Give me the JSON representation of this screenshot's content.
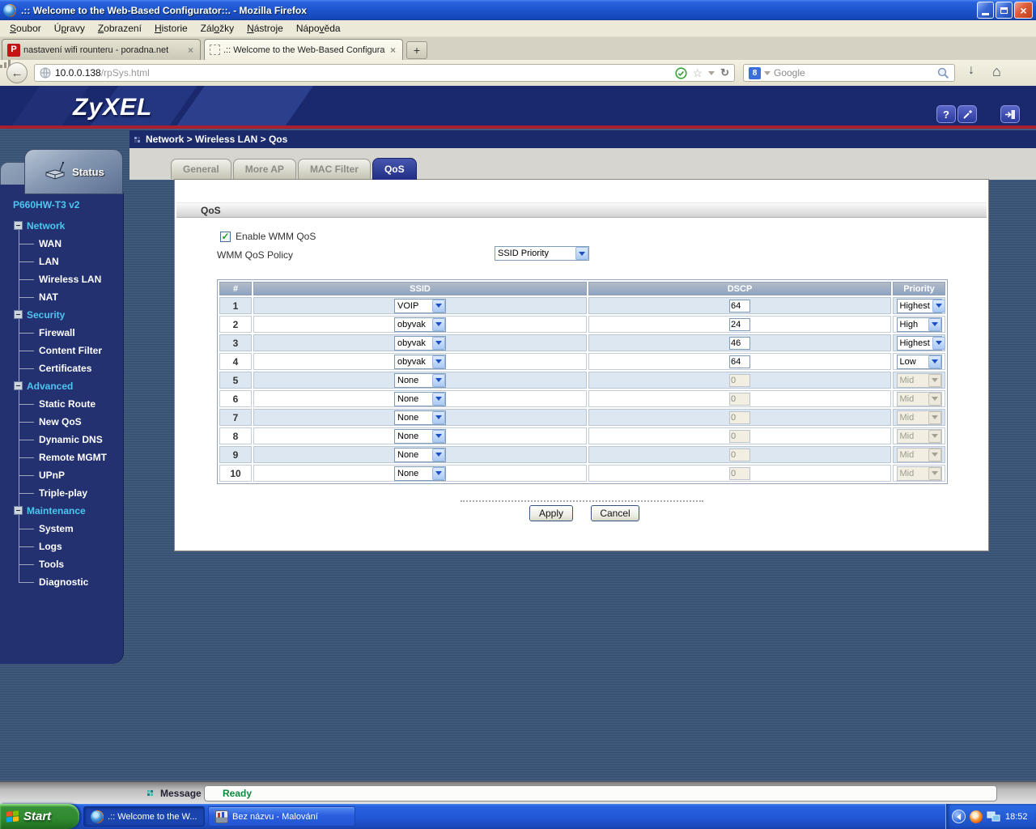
{
  "browser": {
    "title": ".:: Welcome to the Web-Based Configurator::. - Mozilla Firefox",
    "menu": [
      {
        "label": "Soubor",
        "accel": 0
      },
      {
        "label": "Úpravy",
        "accel": 1
      },
      {
        "label": "Zobrazení",
        "accel": 0
      },
      {
        "label": "Historie",
        "accel": 0
      },
      {
        "label": "Záložky",
        "accel": 3
      },
      {
        "label": "Nástroje",
        "accel": 0
      },
      {
        "label": "Nápověda",
        "accel": 4
      }
    ],
    "tabs": [
      {
        "label": "nastavení wifi rounteru - poradna.net",
        "active": false,
        "icon": "poradna"
      },
      {
        "label": ".:: Welcome to the Web-Based Configura...",
        "active": true,
        "icon": "none"
      }
    ],
    "new_tab_label": "+",
    "url": {
      "host": "10.0.0.138",
      "path": "/rpSys.html"
    },
    "search": {
      "engine": "Google"
    }
  },
  "icons": {
    "back": "←",
    "star": "☆",
    "reload": "↻",
    "download": "↓",
    "home": "⌂",
    "close": "×",
    "minimize": "—",
    "help": "?",
    "checkmark": "✓",
    "poradna_letter": "P",
    "google_letter": "8",
    "tab_close": "×"
  },
  "zyxel": {
    "logo": "ZyXEL",
    "breadcrumb": "Network > Wireless LAN > Qos",
    "status_label": "Status",
    "device": "P660HW-T3 v2",
    "nav": [
      {
        "label": "Network",
        "children": [
          "WAN",
          "LAN",
          "Wireless LAN",
          "NAT"
        ]
      },
      {
        "label": "Security",
        "children": [
          "Firewall",
          "Content Filter",
          "Certificates"
        ]
      },
      {
        "label": "Advanced",
        "children": [
          "Static Route",
          "New QoS",
          "Dynamic DNS",
          "Remote MGMT",
          "UPnP",
          "Triple-play"
        ]
      },
      {
        "label": "Maintenance",
        "children": [
          "System",
          "Logs",
          "Tools",
          "Diagnostic"
        ]
      }
    ],
    "tabs": [
      {
        "label": "General",
        "active": false
      },
      {
        "label": "More AP",
        "active": false
      },
      {
        "label": "MAC Filter",
        "active": false
      },
      {
        "label": "QoS",
        "active": true
      }
    ],
    "panel": {
      "section_title": "QoS",
      "enable_label": "Enable WMM QoS",
      "enable_checked": true,
      "policy_label": "WMM QoS Policy",
      "policy_value": "SSID Priority",
      "table": {
        "headers": [
          "#",
          "SSID",
          "DSCP",
          "Priority"
        ],
        "rows": [
          {
            "num": "1",
            "ssid": "VOIP",
            "dscp": "64",
            "priority": "Highest",
            "enabled": true
          },
          {
            "num": "2",
            "ssid": "obyvak",
            "dscp": "24",
            "priority": "High",
            "enabled": true
          },
          {
            "num": "3",
            "ssid": "obyvak",
            "dscp": "46",
            "priority": "Highest",
            "enabled": true
          },
          {
            "num": "4",
            "ssid": "obyvak",
            "dscp": "64",
            "priority": "Low",
            "enabled": true
          },
          {
            "num": "5",
            "ssid": "None",
            "dscp": "0",
            "priority": "Mid",
            "enabled": false
          },
          {
            "num": "6",
            "ssid": "None",
            "dscp": "0",
            "priority": "Mid",
            "enabled": false
          },
          {
            "num": "7",
            "ssid": "None",
            "dscp": "0",
            "priority": "Mid",
            "enabled": false
          },
          {
            "num": "8",
            "ssid": "None",
            "dscp": "0",
            "priority": "Mid",
            "enabled": false
          },
          {
            "num": "9",
            "ssid": "None",
            "dscp": "0",
            "priority": "Mid",
            "enabled": false
          },
          {
            "num": "10",
            "ssid": "None",
            "dscp": "0",
            "priority": "Mid",
            "enabled": false
          }
        ]
      },
      "apply_label": "Apply",
      "cancel_label": "Cancel"
    },
    "message": {
      "label": "Message",
      "value": "Ready"
    }
  },
  "taskbar": {
    "start_label": "Start",
    "tasks": [
      {
        "label": ".:: Welcome to the W...",
        "active": true,
        "icon": "firefox"
      },
      {
        "label": "Bez názvu - Malování",
        "active": false,
        "icon": "paint"
      }
    ],
    "clock": "18:52"
  },
  "colors": {
    "header_navy": "#1a296e",
    "sidebar_navy": "#1b2a6b",
    "sidebar_navy2": "#233170",
    "red_accent": "#aa1f2f",
    "link_cyan": "#4cc6f0",
    "tab_active_navy": "#222e86",
    "table_header_blue": "#8fa3c2",
    "row_alt_blue": "#dce7f2",
    "disabled_beige": "#f2efe2",
    "ready_green": "#0a8a3c",
    "taskbar_blue": "#2862e0",
    "start_green": "#2f8a2f"
  }
}
